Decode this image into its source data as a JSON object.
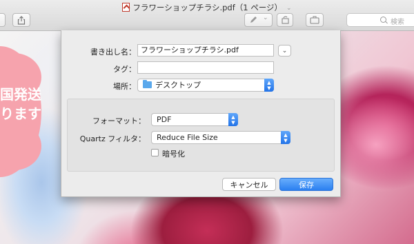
{
  "window": {
    "title": "フラワーショップチラシ.pdf（1 ページ）",
    "search_placeholder": "検索"
  },
  "document": {
    "flyer_text_line1": "国発送",
    "flyer_text_line2": "ります"
  },
  "dialog": {
    "save_as_label": "書き出し名：",
    "save_as_value": "フラワーショップチラシ.pdf",
    "tags_label": "タグ：",
    "tags_value": "",
    "where_label": "場所：",
    "where_value": "デスクトップ",
    "format_label": "フォーマット：",
    "format_value": "PDF",
    "quartz_label": "Quartz フィルタ：",
    "quartz_value": "Reduce File Size",
    "encrypt_label": "暗号化",
    "encrypt_checked": false,
    "cancel_label": "キャンセル",
    "save_label": "保存"
  },
  "colors": {
    "accent": "#2a7ff0",
    "flyer_pink": "#f6a3ad"
  }
}
